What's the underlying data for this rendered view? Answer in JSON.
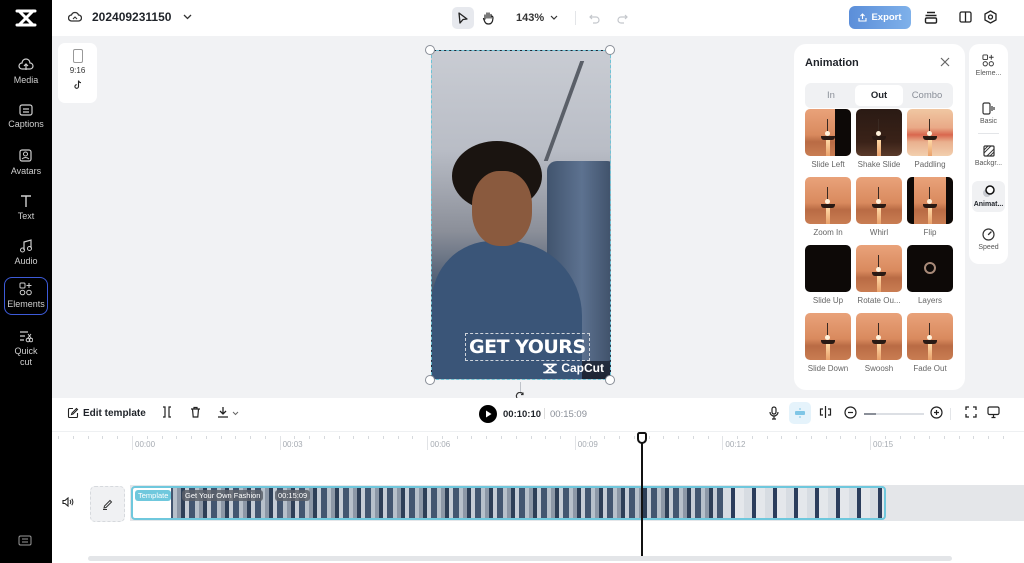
{
  "app": {
    "name": "CapCut",
    "brand_color": "#000000",
    "accent_color": "#3d5bd9",
    "selection_color": "#6fc8dd"
  },
  "topbar": {
    "project_name": "202409231150",
    "zoom_level": "143%",
    "export_label": "Export",
    "icons": [
      "cloud-save-icon",
      "select-pointer-icon",
      "hand-pan-icon",
      "undo-icon",
      "redo-icon",
      "layers-icon",
      "split-view-icon",
      "settings-icon"
    ]
  },
  "left_rail": {
    "items": [
      {
        "label": "Media",
        "icon": "cloud-upload-icon"
      },
      {
        "label": "Captions",
        "icon": "captions-icon"
      },
      {
        "label": "Avatars",
        "icon": "avatar-icon"
      },
      {
        "label": "Text",
        "icon": "text-icon"
      },
      {
        "label": "Audio",
        "icon": "music-note-icon"
      },
      {
        "label": "Elements",
        "icon": "elements-icon",
        "active": true
      },
      {
        "label": "Quick cut",
        "icon": "quick-cut-icon"
      }
    ]
  },
  "canvas": {
    "aspect_ratio": "9:16",
    "platform_icon": "tiktok-icon",
    "overlay_text": "GET YOURS",
    "watermark": "CapCut"
  },
  "animation_panel": {
    "title": "Animation",
    "tabs": [
      {
        "label": "In",
        "active": false
      },
      {
        "label": "Out",
        "active": true
      },
      {
        "label": "Combo",
        "active": false
      }
    ],
    "presets": [
      {
        "label": "Slide Left",
        "style": "slideleft"
      },
      {
        "label": "Shake Slide",
        "style": "shake"
      },
      {
        "label": "Paddling",
        "style": "paddle"
      },
      {
        "label": "Zoom In",
        "style": ""
      },
      {
        "label": "Whirl",
        "style": ""
      },
      {
        "label": "Flip",
        "style": "flip"
      },
      {
        "label": "Slide Up",
        "style": "dark"
      },
      {
        "label": "Rotate Ou...",
        "style": ""
      },
      {
        "label": "Layers",
        "style": "dark layers"
      },
      {
        "label": "Slide Down",
        "style": ""
      },
      {
        "label": "Swoosh",
        "style": ""
      },
      {
        "label": "Fade Out",
        "style": ""
      }
    ]
  },
  "property_rail": {
    "items": [
      {
        "label": "Eleme...",
        "icon": "elements-icon"
      },
      {
        "label": "Basic",
        "icon": "basic-icon"
      },
      {
        "label": "Backgr...",
        "icon": "background-icon"
      },
      {
        "label": "Animat...",
        "icon": "animation-icon",
        "active": true
      },
      {
        "label": "Speed",
        "icon": "speed-icon"
      }
    ]
  },
  "timeline": {
    "edit_template_label": "Edit template",
    "current_time": "00:10:10",
    "total_time": "00:15:09",
    "ruler_labels": [
      "00:00",
      "00:03",
      "00:06",
      "00:09",
      "00:12",
      "00:15"
    ],
    "zoom_slider_value": 0.2,
    "clip": {
      "tag": "Template",
      "name": "Get Your Own Fashion",
      "duration": "00:15:09"
    }
  }
}
